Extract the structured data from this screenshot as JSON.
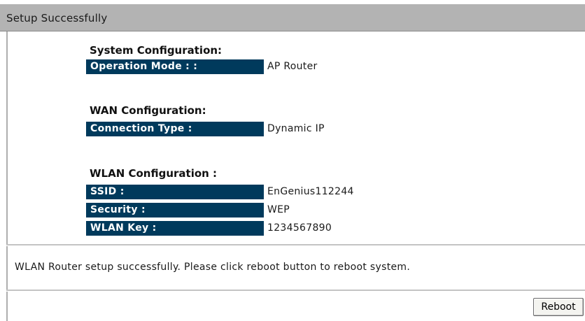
{
  "header": {
    "title": "Setup Successfully"
  },
  "system": {
    "heading": "System Configuration:",
    "rows": [
      {
        "label": "Operation Mode : :",
        "value": "AP Router"
      }
    ]
  },
  "wan": {
    "heading": "WAN Configuration:",
    "rows": [
      {
        "label": "Connection Type :",
        "value": "Dynamic IP"
      }
    ]
  },
  "wlan": {
    "heading": "WLAN Configuration :",
    "rows": [
      {
        "label": "SSID :",
        "value": "EnGenius112244"
      },
      {
        "label": "Security :",
        "value": "WEP"
      },
      {
        "label": "WLAN Key :",
        "value": "1234567890"
      }
    ]
  },
  "message": "WLAN Router setup successfully. Please click reboot button to reboot system.",
  "actions": {
    "reboot_label": "Reboot"
  },
  "colors": {
    "label_background": "#003a5c",
    "titlebar_background": "#b3b3b3"
  }
}
